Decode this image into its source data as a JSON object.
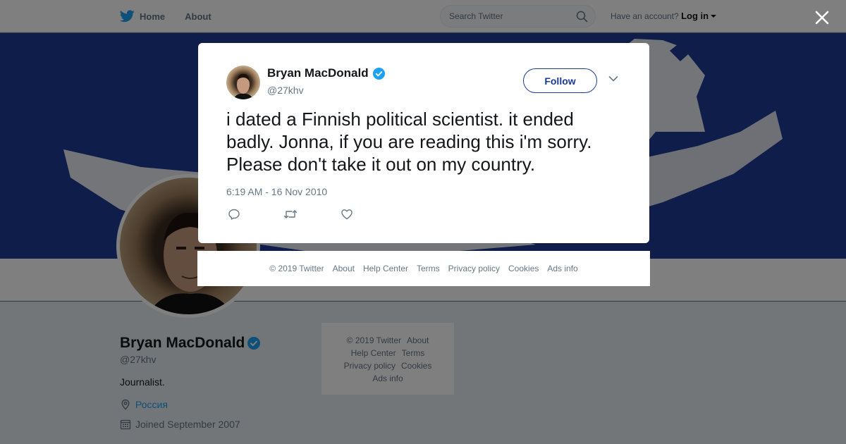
{
  "nav": {
    "home": "Home",
    "about": "About",
    "search_placeholder": "Search Twitter",
    "have_account": "Have an account?",
    "login": "Log in"
  },
  "profile": {
    "name": "Bryan MacDonald",
    "handle": "@27khv",
    "bio": "Journalist.",
    "location": "Россия",
    "joined": "Joined September 2007"
  },
  "side_footer": {
    "copyright": "© 2019 Twitter",
    "about": "About",
    "help": "Help Center",
    "terms": "Terms",
    "privacy": "Privacy policy",
    "cookies": "Cookies",
    "ads": "Ads info"
  },
  "tweet": {
    "name": "Bryan MacDonald",
    "handle": "@27khv",
    "follow_label": "Follow",
    "text": "i dated a Finnish political scientist. it ended badly. Jonna, if you are reading this i'm sorry. Please don't take it out on my country.",
    "timestamp": "6:19 AM - 16 Nov 2010"
  },
  "modal_footer": {
    "copyright": "© 2019 Twitter",
    "about": "About",
    "help": "Help Center",
    "terms": "Terms",
    "privacy": "Privacy policy",
    "cookies": "Cookies",
    "ads": "Ads info"
  },
  "colors": {
    "twitter_blue": "#1da1f2",
    "banner_blue": "#1d3b94",
    "follow_border": "#1b3a94",
    "muted_text": "#657786"
  },
  "icons": [
    "twitter-bird-icon",
    "search-icon",
    "verified-badge-icon",
    "location-icon",
    "calendar-icon",
    "close-icon",
    "chevron-down-icon",
    "reply-icon",
    "retweet-icon",
    "like-icon"
  ]
}
